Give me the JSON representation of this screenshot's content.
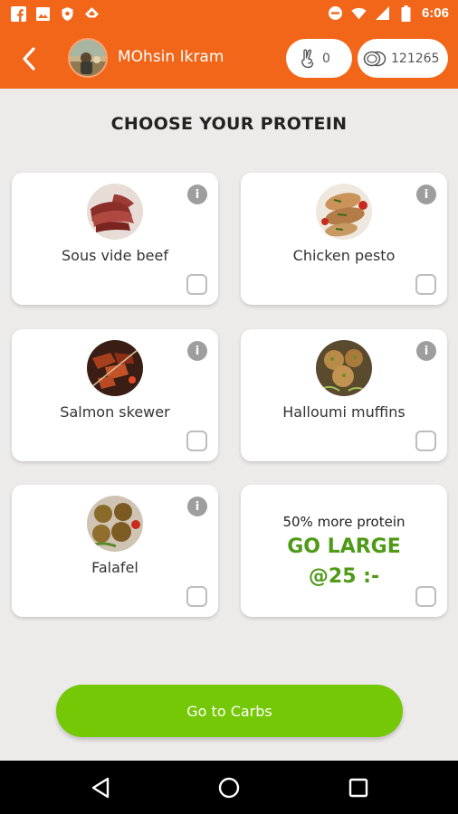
{
  "status_bar": {
    "time": "6:06",
    "left_icons": [
      "facebook-icon",
      "image-icon",
      "shield-icon",
      "feedly-icon"
    ],
    "right_icons": [
      "do-not-disturb-icon",
      "wifi-icon",
      "signal-icon",
      "battery-icon"
    ]
  },
  "header": {
    "user_name": "MOhsin Ikram",
    "peace_count": "0",
    "coins": "121265"
  },
  "page": {
    "title": "CHOOSE YOUR PROTEIN"
  },
  "info_glyph": "i",
  "items": [
    {
      "label": "Sous vide beef"
    },
    {
      "label": "Chicken pesto"
    },
    {
      "label": "Salmon skewer"
    },
    {
      "label": "Halloumi muffins"
    },
    {
      "label": "Falafel"
    }
  ],
  "promo": {
    "subtitle": "50% more protein",
    "title": "GO LARGE",
    "price": "@25 :-"
  },
  "cta": {
    "label": "Go to Carbs"
  },
  "colors": {
    "brand_orange": "#f2661a",
    "accent_green": "#74c805",
    "promo_green": "#4f9a17"
  }
}
